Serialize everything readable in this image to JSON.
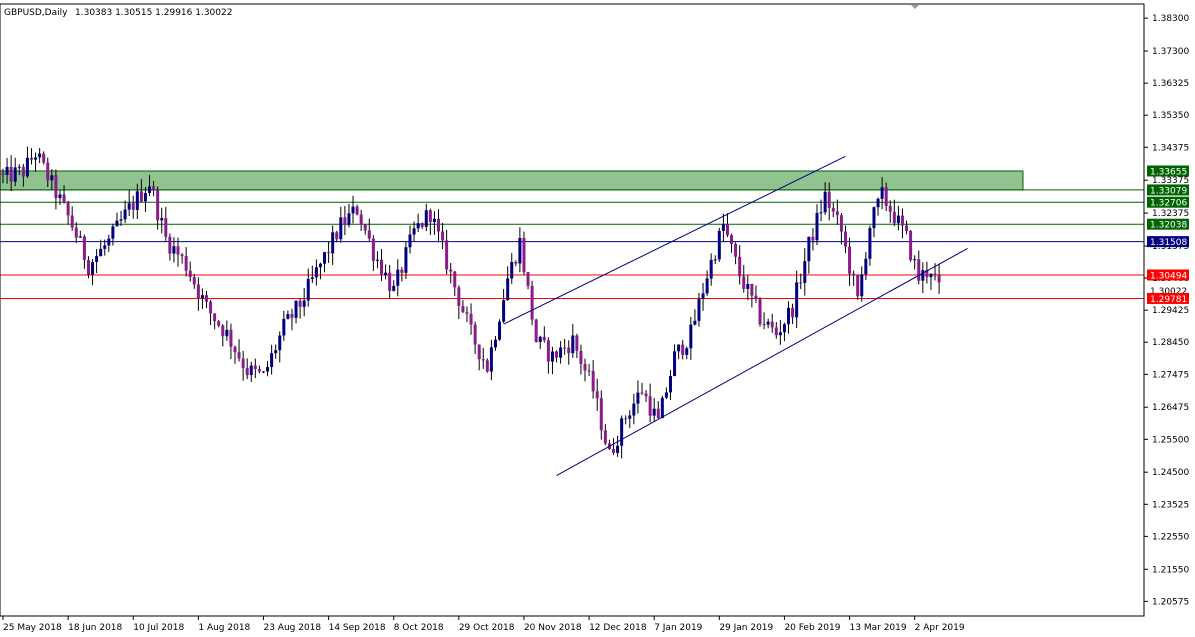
{
  "header": {
    "symbol": "GBPUSD,Daily",
    "ohlc": "1.30383 1.30515 1.29916 1.30022"
  },
  "chart_data": {
    "type": "candlestick",
    "symbol": "GBPUSD",
    "timeframe": "Daily",
    "ylim": [
      1.2013,
      1.3873
    ],
    "y_ticks": [
      "1.38300",
      "1.37300",
      "1.36325",
      "1.35350",
      "1.34375",
      "1.33375",
      "1.32375",
      "1.31375",
      "1.30400",
      "1.29425",
      "1.28450",
      "1.27475",
      "1.26475",
      "1.25500",
      "1.24500",
      "1.23525",
      "1.22550",
      "1.21550",
      "1.20575"
    ],
    "x_ticks": [
      "25 May 2018",
      "18 Jun 2018",
      "10 Jul 2018",
      "1 Aug 2018",
      "23 Aug 2018",
      "14 Sep 2018",
      "8 Oct 2018",
      "29 Oct 2018",
      "20 Nov 2018",
      "12 Dec 2018",
      "7 Jan 2019",
      "29 Jan 2019",
      "20 Feb 2019",
      "13 Mar 2019",
      "2 Apr 2019"
    ],
    "bar_count": 231,
    "colors": {
      "bull": "#000080",
      "bear": "#8b1a8b",
      "wick": "#000000",
      "zone": "#7cb87c",
      "resistance": "#006400",
      "pivot": "#000080",
      "support": "#ff0000"
    },
    "close_waypoints": [
      [
        0,
        1.334
      ],
      [
        6,
        1.3365
      ],
      [
        9,
        1.342
      ],
      [
        14,
        1.33
      ],
      [
        18,
        1.32
      ],
      [
        22,
        1.308
      ],
      [
        27,
        1.315
      ],
      [
        32,
        1.325
      ],
      [
        37,
        1.333
      ],
      [
        41,
        1.316
      ],
      [
        46,
        1.308
      ],
      [
        51,
        1.295
      ],
      [
        56,
        1.287
      ],
      [
        61,
        1.276
      ],
      [
        65,
        1.274
      ],
      [
        70,
        1.289
      ],
      [
        74,
        1.296
      ],
      [
        79,
        1.308
      ],
      [
        84,
        1.32
      ],
      [
        88,
        1.325
      ],
      [
        92,
        1.312
      ],
      [
        97,
        1.3
      ],
      [
        102,
        1.318
      ],
      [
        106,
        1.324
      ],
      [
        111,
        1.305
      ],
      [
        116,
        1.287
      ],
      [
        120,
        1.277
      ],
      [
        125,
        1.304
      ],
      [
        128,
        1.315
      ],
      [
        132,
        1.285
      ],
      [
        136,
        1.28
      ],
      [
        141,
        1.285
      ],
      [
        146,
        1.27
      ],
      [
        150,
        1.25
      ],
      [
        154,
        1.262
      ],
      [
        158,
        1.27
      ],
      [
        162,
        1.26
      ],
      [
        166,
        1.28
      ],
      [
        170,
        1.287
      ],
      [
        174,
        1.305
      ],
      [
        178,
        1.32
      ],
      [
        182,
        1.305
      ],
      [
        187,
        1.292
      ],
      [
        191,
        1.287
      ],
      [
        195,
        1.295
      ],
      [
        199,
        1.314
      ],
      [
        203,
        1.329
      ],
      [
        207,
        1.318
      ],
      [
        211,
        1.297
      ],
      [
        214,
        1.32
      ],
      [
        217,
        1.329
      ],
      [
        220,
        1.323
      ],
      [
        223,
        1.316
      ],
      [
        226,
        1.304
      ],
      [
        229,
        1.307
      ],
      [
        231,
        1.3002
      ]
    ],
    "zone": {
      "top": 1.33655,
      "bottom": 1.33079
    },
    "horizontal_levels": [
      {
        "value": 1.33079,
        "label": "1.33079",
        "kind": "resistance"
      },
      {
        "value": 1.32706,
        "label": "1.32706",
        "kind": "resistance"
      },
      {
        "value": 1.32038,
        "label": "1.32038",
        "kind": "resistance"
      },
      {
        "value": 1.31508,
        "label": "1.31508",
        "kind": "pivot"
      },
      {
        "value": 1.30494,
        "label": "1.30494",
        "kind": "support"
      },
      {
        "value": 1.29781,
        "label": "1.29781",
        "kind": "support"
      }
    ],
    "price_tags": [
      {
        "value": 1.33655,
        "label": "1.33655",
        "kind": "zone"
      },
      {
        "value": 1.33079,
        "label": "1.33079",
        "kind": "resistance"
      },
      {
        "value": 1.32706,
        "label": "1.32706",
        "kind": "resistance"
      },
      {
        "value": 1.32038,
        "label": "1.32038",
        "kind": "resistance"
      },
      {
        "value": 1.31508,
        "label": "1.31508",
        "kind": "pivot"
      },
      {
        "value": 1.30494,
        "label": "1.30494",
        "kind": "support"
      },
      {
        "value": 1.30022,
        "label": "1.30022",
        "kind": "current"
      },
      {
        "value": 1.29781,
        "label": "1.29781",
        "kind": "support"
      }
    ],
    "channel": {
      "upper": [
        [
          123,
          1.29
        ],
        [
          207,
          1.341
        ]
      ],
      "lower": [
        [
          136,
          1.244
        ],
        [
          237,
          1.313
        ]
      ]
    }
  }
}
